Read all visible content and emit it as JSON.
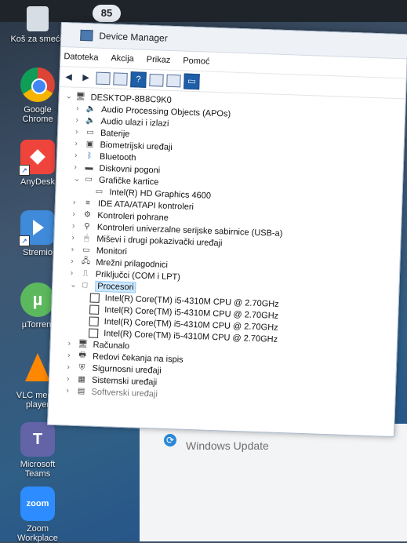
{
  "desktop": {
    "taskbar_badge": "85",
    "icons": [
      {
        "label": "Koš za smeće",
        "icon": "recycle-bin-icon"
      },
      {
        "label": "Google Chrome",
        "icon": "chrome-icon"
      },
      {
        "label": "AnyDesk",
        "icon": "anydesk-icon"
      },
      {
        "label": "Stremio",
        "icon": "stremio-icon"
      },
      {
        "label": "µTorrent",
        "icon": "utorrent-icon"
      },
      {
        "label": "VLC media player",
        "icon": "vlc-icon"
      },
      {
        "label": "Microsoft Teams",
        "icon": "teams-icon"
      },
      {
        "label": "Zoom Workplace",
        "icon": "zoom-icon"
      }
    ]
  },
  "device_manager": {
    "title": "Device Manager",
    "menus": [
      "Datoteka",
      "Akcija",
      "Prikaz",
      "Pomoć"
    ],
    "tree": {
      "root": "DESKTOP-8B8C9K0",
      "items": [
        {
          "label": "Audio Processing Objects (APOs)",
          "icon": "speaker-icon"
        },
        {
          "label": "Audio ulazi i izlazi",
          "icon": "speaker-icon"
        },
        {
          "label": "Baterije",
          "icon": "battery-icon"
        },
        {
          "label": "Biometrijski uređaji",
          "icon": "fingerprint-icon"
        },
        {
          "label": "Bluetooth",
          "icon": "bluetooth-icon"
        },
        {
          "label": "Diskovni pogoni",
          "icon": "drive-icon"
        },
        {
          "label": "Grafičke kartice",
          "icon": "display-adapter-icon",
          "expanded": true,
          "children": [
            "Intel(R) HD Graphics 4600"
          ]
        },
        {
          "label": "IDE ATA/ATAPI kontroleri",
          "icon": "ide-icon"
        },
        {
          "label": "Kontroleri pohrane",
          "icon": "storage-controller-icon"
        },
        {
          "label": "Kontroleri univerzalne serijske sabirnice (USB-a)",
          "icon": "usb-icon"
        },
        {
          "label": "Miševi i drugi pokazivački uređaji",
          "icon": "mouse-icon"
        },
        {
          "label": "Monitori",
          "icon": "monitor-icon"
        },
        {
          "label": "Mrežni prilagodnici",
          "icon": "network-icon"
        },
        {
          "label": "Priključci (COM i LPT)",
          "icon": "port-icon"
        },
        {
          "label": "Procesori",
          "icon": "processor-icon",
          "expanded": true,
          "selected": true,
          "children": [
            "Intel(R) Core(TM) i5-4310M CPU @ 2.70GHz",
            "Intel(R) Core(TM) i5-4310M CPU @ 2.70GHz",
            "Intel(R) Core(TM) i5-4310M CPU @ 2.70GHz",
            "Intel(R) Core(TM) i5-4310M CPU @ 2.70GHz"
          ]
        },
        {
          "label": "Računalo",
          "icon": "computer-icon"
        },
        {
          "label": "Redovi čekanja na ispis",
          "icon": "printer-icon"
        },
        {
          "label": "Sigurnosni uređaji",
          "icon": "security-icon"
        },
        {
          "label": "Sistemski uređaji",
          "icon": "system-icon"
        },
        {
          "label": "Softverski uređaji",
          "icon": "software-icon"
        }
      ]
    }
  },
  "background_window": {
    "label": "Windows Update"
  },
  "colors": {
    "desktop_bg": "#2f5e86",
    "window_bg": "#ffffff",
    "selection": "#cce8ff"
  }
}
